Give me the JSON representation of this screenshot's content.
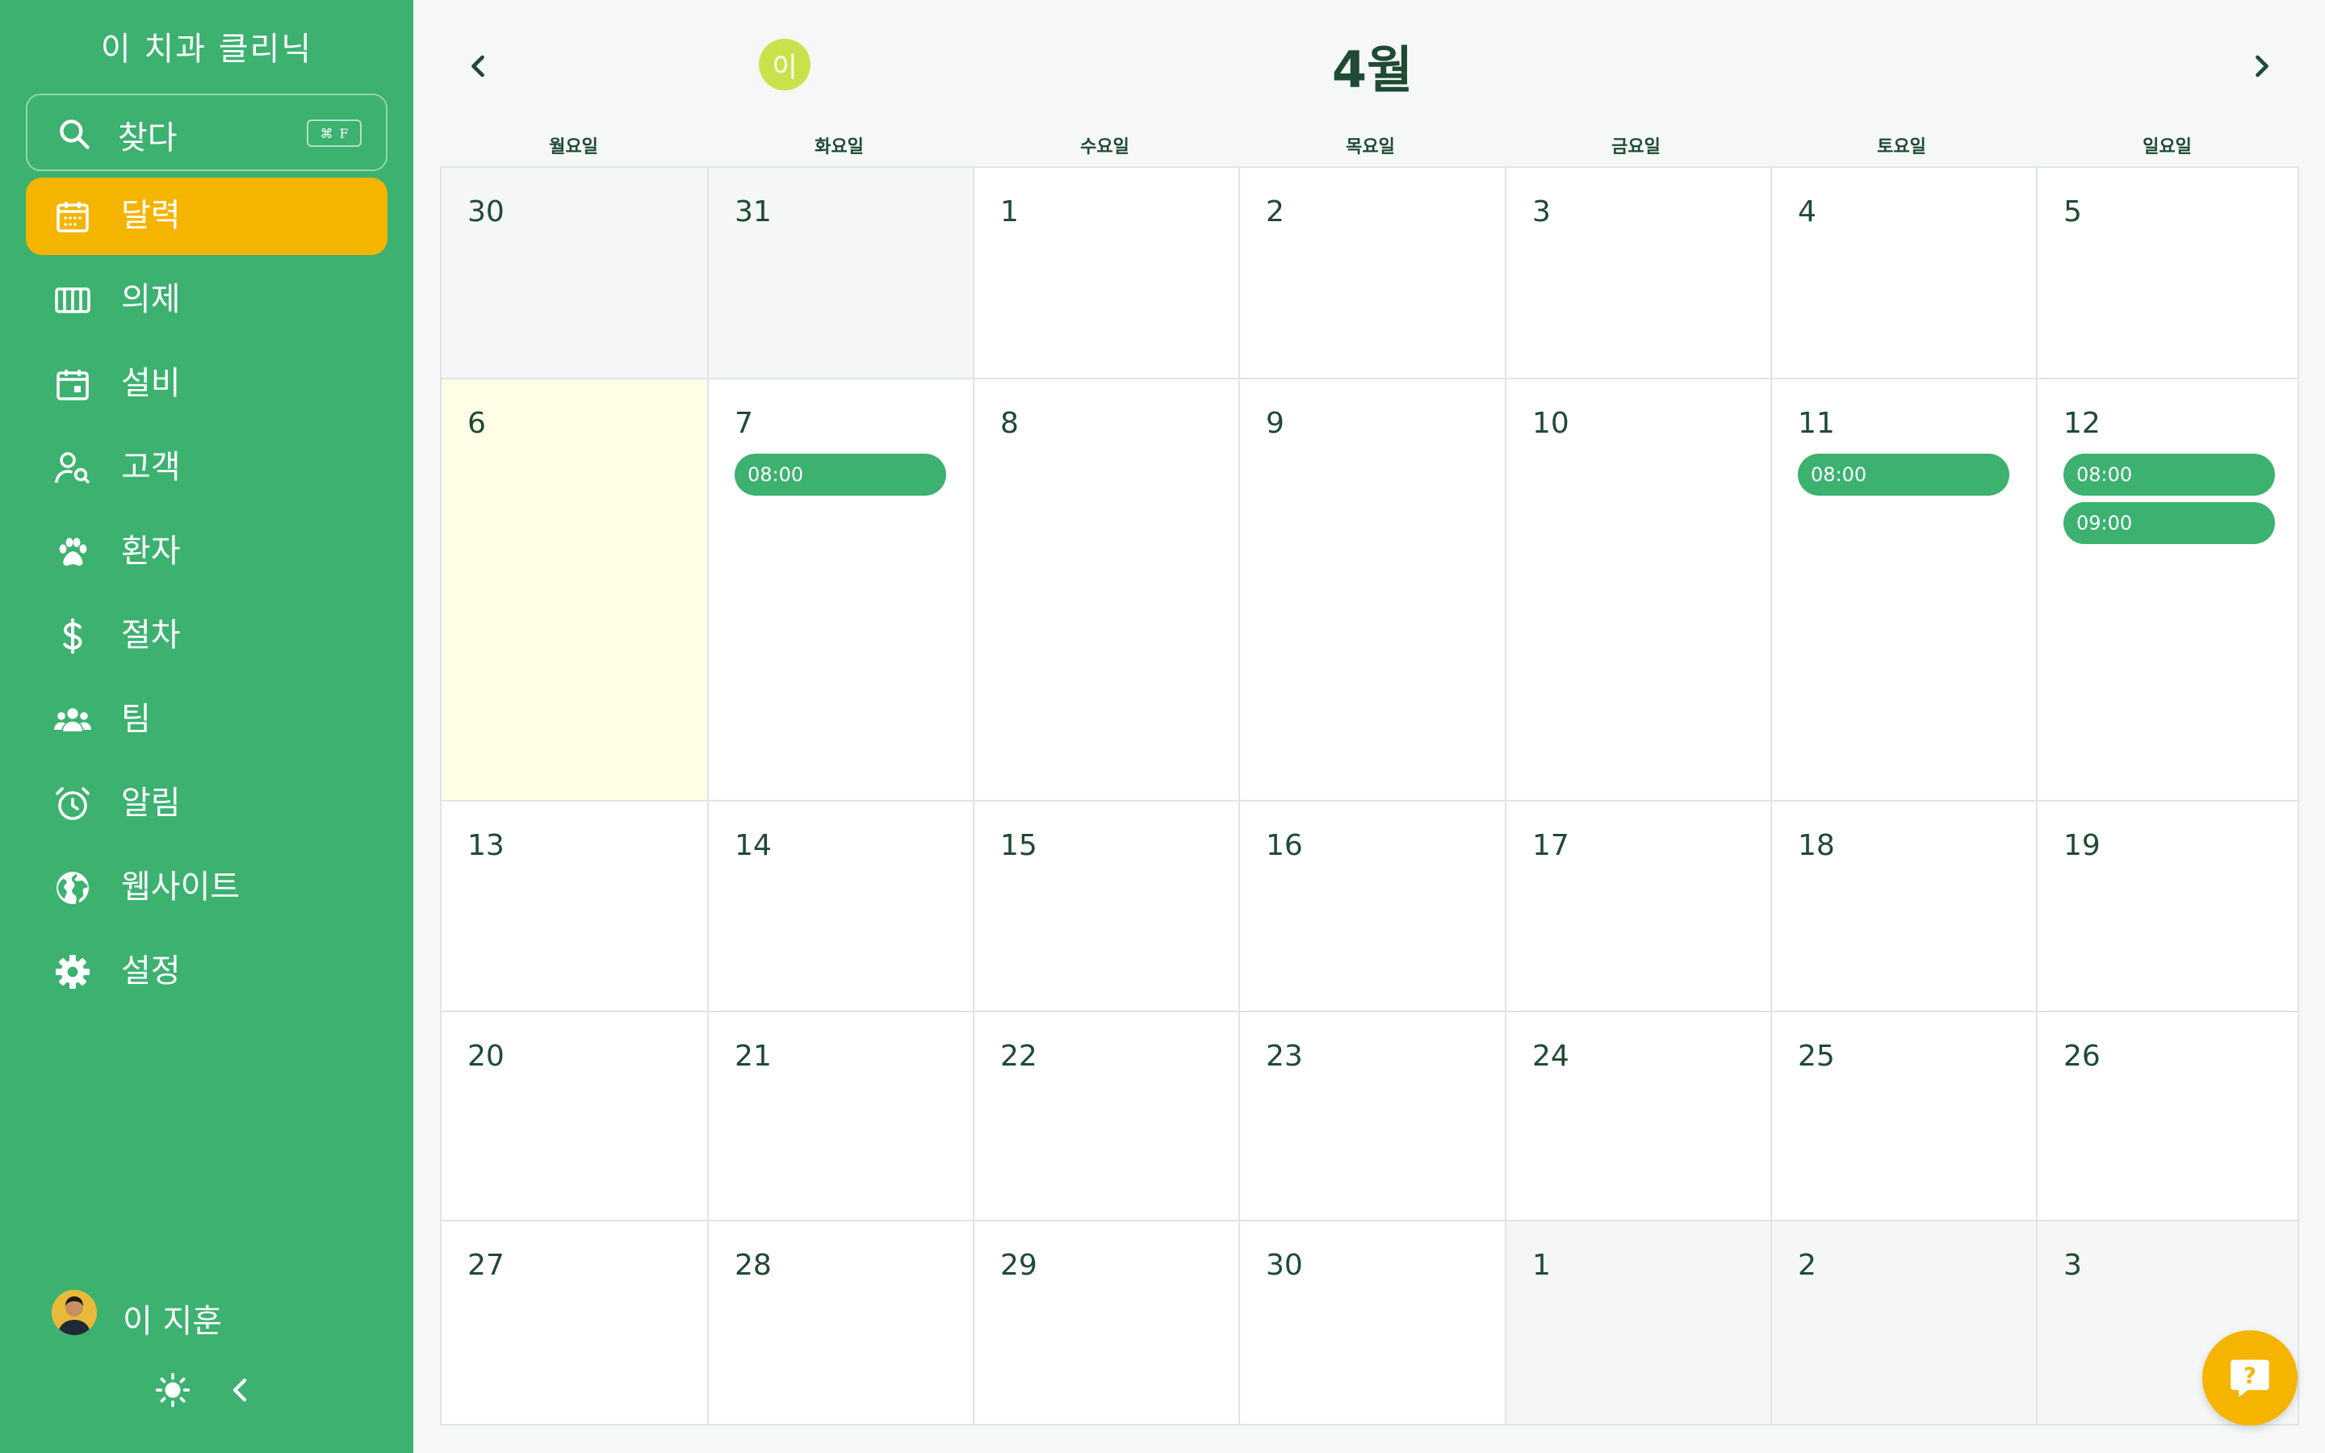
{
  "sidebar": {
    "clinic_name": "이 치과 클리닉",
    "search": {
      "label": "찾다",
      "shortcut_symbol": "⌘",
      "shortcut_key": "F"
    },
    "items": [
      {
        "label": "달력",
        "icon": "calendar-icon",
        "active": true
      },
      {
        "label": "의제",
        "icon": "agenda-columns-icon",
        "active": false
      },
      {
        "label": "설비",
        "icon": "calendar-day-icon",
        "active": false
      },
      {
        "label": "고객",
        "icon": "user-search-icon",
        "active": false
      },
      {
        "label": "환자",
        "icon": "paw-icon",
        "active": false
      },
      {
        "label": "절차",
        "icon": "dollar-icon",
        "active": false
      },
      {
        "label": "팀",
        "icon": "team-icon",
        "active": false
      },
      {
        "label": "알림",
        "icon": "alarm-clock-icon",
        "active": false
      },
      {
        "label": "웹사이트",
        "icon": "globe-icon",
        "active": false
      },
      {
        "label": "설정",
        "icon": "gear-icon",
        "active": false
      }
    ],
    "user": {
      "name": "이 지훈"
    }
  },
  "header": {
    "today_badge": "이",
    "month_title": "4월"
  },
  "weekdays": [
    "월요일",
    "화요일",
    "수요일",
    "목요일",
    "금요일",
    "토요일",
    "일요일"
  ],
  "weeks": [
    [
      {
        "day": "30",
        "muted": true,
        "events": []
      },
      {
        "day": "31",
        "muted": true,
        "events": []
      },
      {
        "day": "1",
        "events": []
      },
      {
        "day": "2",
        "events": []
      },
      {
        "day": "3",
        "events": []
      },
      {
        "day": "4",
        "events": []
      },
      {
        "day": "5",
        "events": []
      }
    ],
    [
      {
        "day": "6",
        "today": true,
        "events": []
      },
      {
        "day": "7",
        "events": [
          "08:00"
        ]
      },
      {
        "day": "8",
        "events": []
      },
      {
        "day": "9",
        "events": []
      },
      {
        "day": "10",
        "events": []
      },
      {
        "day": "11",
        "events": [
          "08:00"
        ]
      },
      {
        "day": "12",
        "events": [
          "08:00",
          "09:00"
        ]
      }
    ],
    [
      {
        "day": "13",
        "events": []
      },
      {
        "day": "14",
        "events": []
      },
      {
        "day": "15",
        "events": []
      },
      {
        "day": "16",
        "events": []
      },
      {
        "day": "17",
        "events": []
      },
      {
        "day": "18",
        "events": []
      },
      {
        "day": "19",
        "events": []
      }
    ],
    [
      {
        "day": "20",
        "events": []
      },
      {
        "day": "21",
        "events": []
      },
      {
        "day": "22",
        "events": []
      },
      {
        "day": "23",
        "events": []
      },
      {
        "day": "24",
        "events": []
      },
      {
        "day": "25",
        "events": []
      },
      {
        "day": "26",
        "events": []
      }
    ],
    [
      {
        "day": "27",
        "events": []
      },
      {
        "day": "28",
        "events": []
      },
      {
        "day": "29",
        "events": []
      },
      {
        "day": "30",
        "events": []
      },
      {
        "day": "1",
        "muted": true,
        "events": []
      },
      {
        "day": "2",
        "muted": true,
        "events": []
      },
      {
        "day": "3",
        "muted": true,
        "events": []
      }
    ]
  ],
  "colors": {
    "sidebar": "#3cb170",
    "active_nav": "#f5b400",
    "event": "#3cb170",
    "today_cell": "#fefee6",
    "today_badge": "#cbe14a",
    "help_button": "#f5b400"
  }
}
